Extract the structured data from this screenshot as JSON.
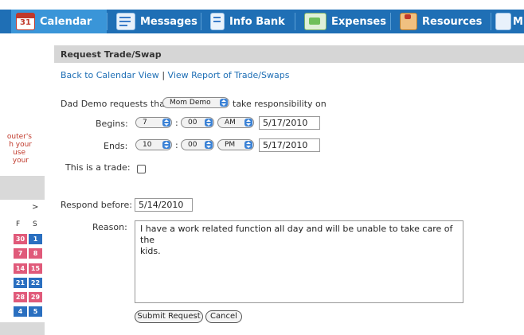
{
  "nav": {
    "tabs": [
      {
        "label": "Calendar",
        "icon": "calendar-icon",
        "active": true,
        "badge": "31"
      },
      {
        "label": "Messages",
        "icon": "messages-icon",
        "active": false
      },
      {
        "label": "Info Bank",
        "icon": "info-bank-icon",
        "active": false
      },
      {
        "label": "Expenses",
        "icon": "expenses-icon",
        "active": false
      },
      {
        "label": "Resources",
        "icon": "resources-icon",
        "active": false
      },
      {
        "label": "M",
        "icon": "more-icon",
        "active": false
      }
    ]
  },
  "sidebar": {
    "promo_lines": [
      "outer's",
      "h your",
      "use",
      "your"
    ],
    "prev": "",
    "next": ">",
    "day_headers": [
      "F",
      "S"
    ],
    "calendar_cells": [
      [
        "30",
        "1"
      ],
      [
        "7",
        "8"
      ],
      [
        "14",
        "15"
      ],
      [
        "21",
        "22"
      ],
      [
        "28",
        "29"
      ],
      [
        "4",
        "5"
      ]
    ]
  },
  "page": {
    "title": "Request Trade/Swap",
    "back_link": "Back to Calendar View",
    "link_separator": "|",
    "report_link": "View Report of Trade/Swaps",
    "request_prefix": "Dad Demo requests that",
    "person_select": "Mom Demo",
    "request_suffix": "take responsibility on",
    "begins_label": "Begins:",
    "begins_hour": "7",
    "begins_minute": "00",
    "begins_ampm": "AM",
    "begins_date": "5/17/2010",
    "ends_label": "Ends:",
    "ends_hour": "10",
    "ends_minute": "00",
    "ends_ampm": "PM",
    "ends_date": "5/17/2010",
    "colon": ":",
    "trade_label": "This is a trade:",
    "respond_label": "Respond before:",
    "respond_date": "5/14/2010",
    "reason_label": "Reason:",
    "reason_text": "I have a work related function all day and will be unable to take care of the\nkids.",
    "submit_label": "Submit Request",
    "cancel_label": "Cancel"
  },
  "colors": {
    "nav_bg": "#1f6fb5",
    "nav_active": "#3a95d8",
    "calendar_pink": "#e05a7a",
    "calendar_blue": "#2a6fc0",
    "link": "#1f6fb5"
  }
}
